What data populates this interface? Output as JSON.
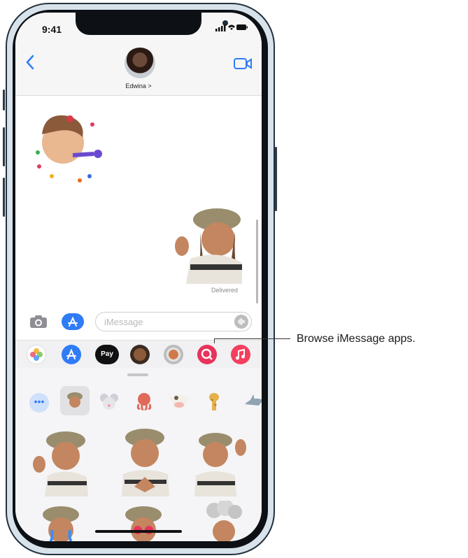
{
  "status": {
    "time": "9:41"
  },
  "header": {
    "contact_name": "Edwina >"
  },
  "thread": {
    "delivered_label": "Delivered"
  },
  "compose": {
    "placeholder": "iMessage"
  },
  "drawer": {
    "apple_pay_label": "Pay"
  },
  "callout": {
    "text": "Browse iMessage apps."
  },
  "picker": {
    "more_label": "•••"
  },
  "colors": {
    "accent": "#2f7cf6",
    "header_bg": "#f6f6f6",
    "panel_bg": "#f5f5f7"
  }
}
